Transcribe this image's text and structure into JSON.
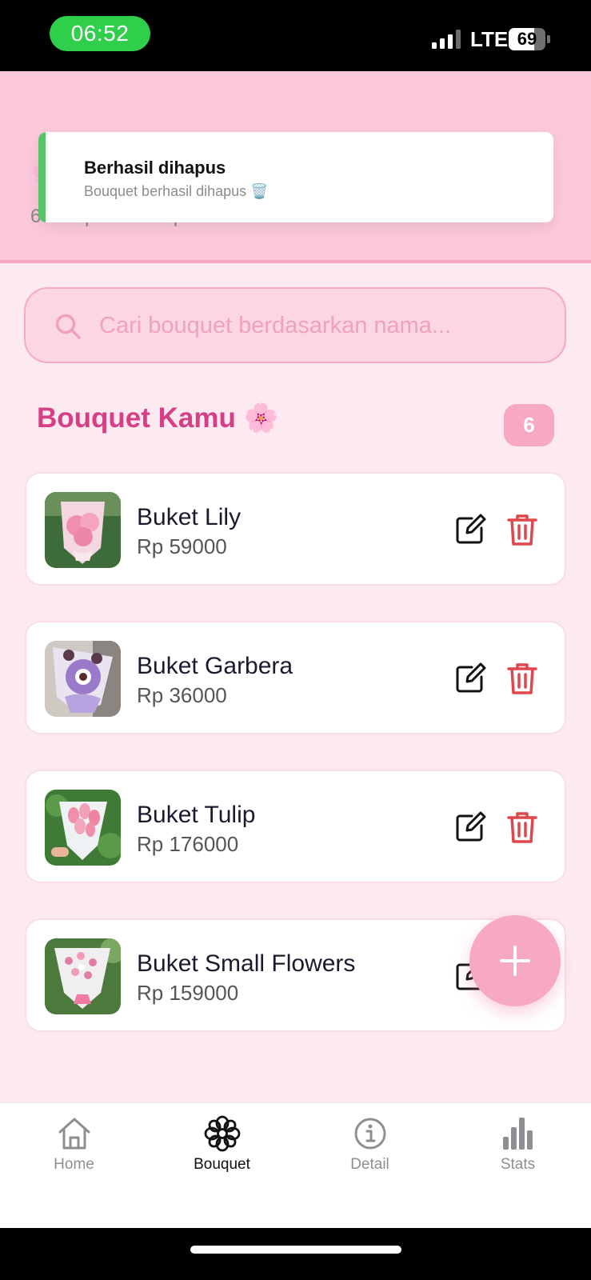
{
  "status_bar": {
    "time": "06:52",
    "network": "LTE",
    "battery": "69",
    "battery_level": 0.69
  },
  "header": {
    "emoji": "🌸",
    "subtitle": "6 bouquet tersimpan"
  },
  "toast": {
    "title": "Berhasil dihapus",
    "message": "Bouquet berhasil dihapus 🗑️",
    "accent": "#59c36a"
  },
  "search": {
    "placeholder": "Cari bouquet berdasarkan nama...",
    "value": ""
  },
  "section": {
    "title": "Bouquet Kamu 🌸",
    "count": "6"
  },
  "bouquets": [
    {
      "name": "Buket Lily",
      "price": "Rp 59000",
      "thumb": "pink-bouquet"
    },
    {
      "name": "Buket Garbera",
      "price": "Rp 36000",
      "thumb": "purple-bouquet"
    },
    {
      "name": "Buket Tulip",
      "price": "Rp 176000",
      "thumb": "tulip-bouquet"
    },
    {
      "name": "Buket Small Flowers",
      "price": "Rp 159000",
      "thumb": "small-flowers-bouquet"
    }
  ],
  "nav": [
    {
      "label": "Home",
      "icon": "home-icon",
      "active": false
    },
    {
      "label": "Bouquet",
      "icon": "flower-icon",
      "active": true
    },
    {
      "label": "Detail",
      "icon": "info-icon",
      "active": false
    },
    {
      "label": "Stats",
      "icon": "bar-chart-icon",
      "active": false
    }
  ],
  "colors": {
    "accent_pink": "#d63f86",
    "header_bg": "#fcc8dc",
    "fab": "#f7a8c5",
    "delete": "#e0474c"
  }
}
